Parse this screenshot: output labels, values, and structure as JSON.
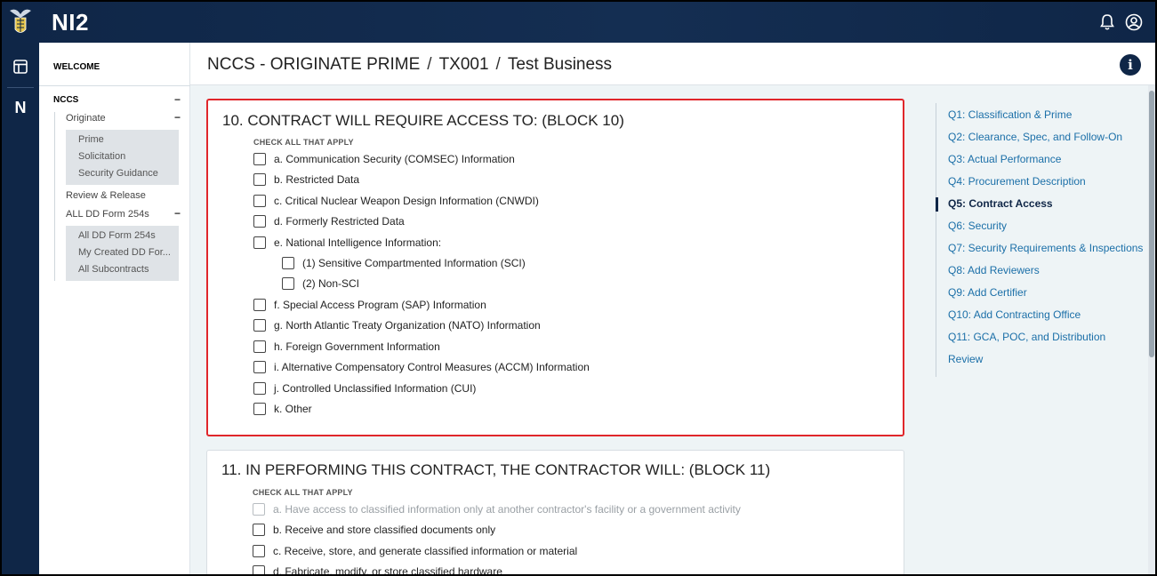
{
  "app": {
    "name": "NI2",
    "rail_letter": "N"
  },
  "sidebar": {
    "welcome": "WELCOME",
    "nccs": "NCCS",
    "originate": "Originate",
    "originate_items": [
      "Prime",
      "Solicitation",
      "Security Guidance"
    ],
    "review_release": "Review & Release",
    "all_dd": "ALL DD Form 254s",
    "all_dd_items": [
      "All DD Form 254s",
      "My Created DD For...",
      "All Subcontracts"
    ],
    "collapse_symbol": "−"
  },
  "header": {
    "title": "NCCS - ORIGINATE PRIME",
    "separator": "/",
    "code": "TX001",
    "business": "Test Business",
    "info_symbol": "i"
  },
  "block10": {
    "title": "10. CONTRACT WILL REQUIRE ACCESS TO: (BLOCK 10)",
    "check_all": "CHECK ALL THAT APPLY",
    "options": [
      "a. Communication Security (COMSEC) Information",
      "b. Restricted Data",
      "c. Critical Nuclear Weapon Design Information (CNWDI)",
      "d. Formerly Restricted Data",
      "e. National Intelligence Information:",
      "(1) Sensitive Compartmented Information (SCI)",
      "(2) Non-SCI",
      "f. Special Access Program (SAP) Information",
      "g. North Atlantic Treaty Organization (NATO) Information",
      "h. Foreign Government Information",
      "i. Alternative Compensatory Control Measures (ACCM) Information",
      "j. Controlled Unclassified Information (CUI)",
      "k. Other"
    ]
  },
  "block11": {
    "title": "11. IN PERFORMING THIS CONTRACT, THE CONTRACTOR WILL: (BLOCK 11)",
    "check_all": "CHECK ALL THAT APPLY",
    "options": [
      "a. Have access to classified information only at another contractor's facility or a government activity",
      "b. Receive and store classified documents only",
      "c. Receive, store, and generate classified information or material",
      "d. Fabricate, modify, or store classified hardware"
    ]
  },
  "qnav": {
    "items": [
      "Q1: Classification & Prime",
      "Q2: Clearance, Spec, and Follow-On",
      "Q3: Actual Performance",
      "Q4: Procurement Description",
      "Q5: Contract Access",
      "Q6: Security",
      "Q7: Security Requirements & Inspections",
      "Q8: Add Reviewers",
      "Q9: Add Certifier",
      "Q10: Add Contracting Office",
      "Q11: GCA, POC, and Distribution",
      "Review"
    ],
    "current": "Q5: Contract Access"
  },
  "colors": {
    "navy": "#0f2647",
    "link": "#1b6fa8",
    "active_border": "#e0262b"
  }
}
